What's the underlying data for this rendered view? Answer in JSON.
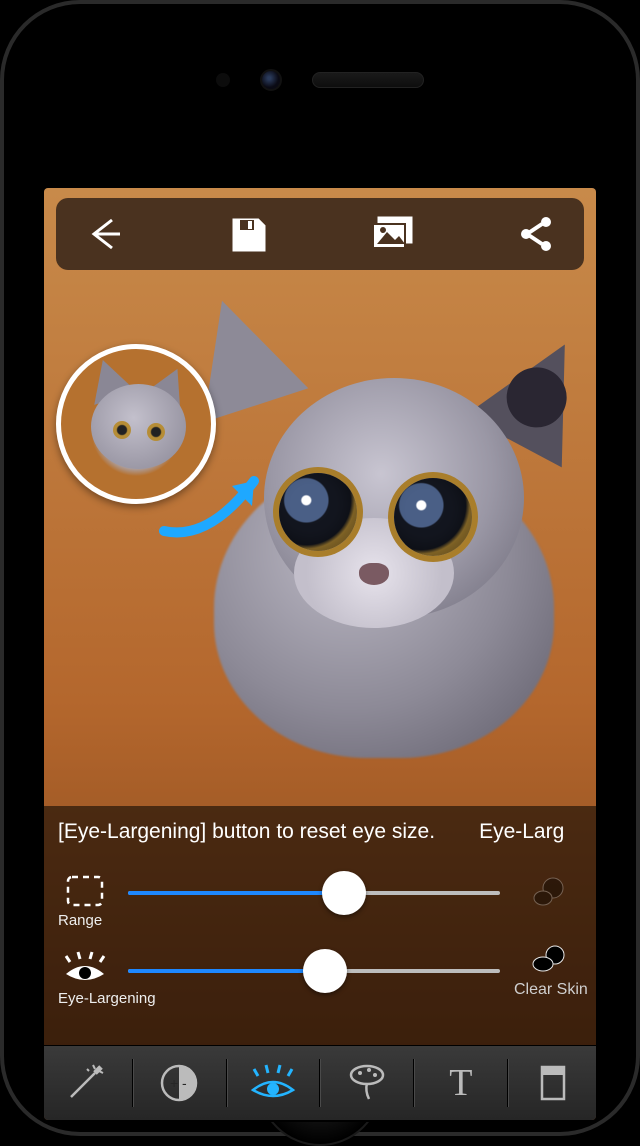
{
  "toolbar": {
    "back": "back-icon",
    "save": "save-icon",
    "gallery": "gallery-icon",
    "share": "share-icon"
  },
  "hint": {
    "text_left": "[Eye-Largening] button to reset eye size.",
    "text_right": "Eye-Larg"
  },
  "controls": {
    "range": {
      "label": "Range",
      "value": 0.58
    },
    "eye": {
      "label": "Eye-Largening",
      "value": 0.53
    },
    "clear_skin_label": "Clear Skin"
  },
  "tabs": {
    "items": [
      "magic-wand",
      "contrast",
      "eye-beauty",
      "brush",
      "text",
      "frame"
    ],
    "text_glyph": "T",
    "active_index": 2
  },
  "colors": {
    "toolbar_bg": "#4a321f",
    "canvas_bg": "#b4672d",
    "accent_blue": "#1e88ff",
    "active_blue": "#23b4ff"
  }
}
